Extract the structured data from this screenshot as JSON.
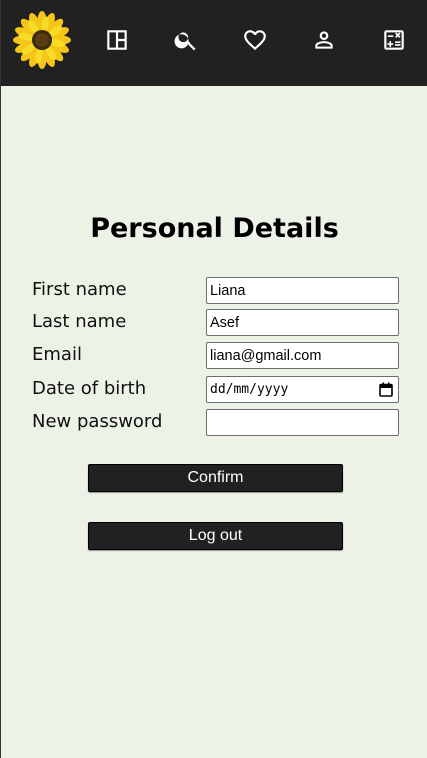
{
  "nav": {
    "icons": [
      "sunflower-logo",
      "dashboard-icon",
      "search-icon",
      "heart-icon",
      "person-icon",
      "calculator-icon"
    ]
  },
  "page": {
    "title": "Personal Details"
  },
  "form": {
    "first_name": {
      "label": "First name",
      "value": "Liana"
    },
    "last_name": {
      "label": "Last name",
      "value": "Asef"
    },
    "email": {
      "label": "Email",
      "value": "liana@gmail.com"
    },
    "dob": {
      "label": "Date of birth",
      "placeholder": "dd/mm/yyyy"
    },
    "password": {
      "label": "New password",
      "value": ""
    }
  },
  "buttons": {
    "confirm": "Confirm",
    "logout": "Log out"
  },
  "colors": {
    "background": "#edf2e6",
    "topbar": "#212121",
    "button": "#212121"
  }
}
